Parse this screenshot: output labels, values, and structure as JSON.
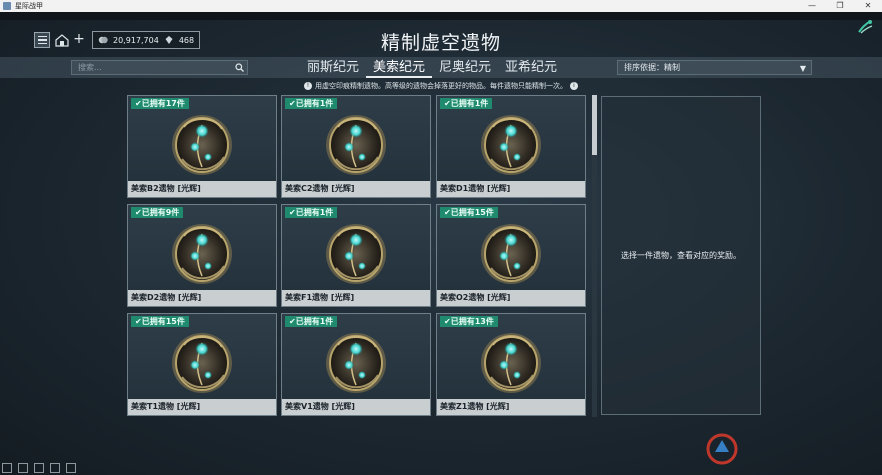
{
  "window": {
    "title": "星际战甲",
    "controls": [
      "—",
      "❐",
      "✕"
    ]
  },
  "toolbar": {
    "credits": "20,917,704",
    "platinum": "468"
  },
  "page": {
    "title": "精制虚空遗物",
    "info": "用虚空印痕精制遗物。高等级的遗物会掉落更好的物品。每件遗物只能精制一次。"
  },
  "search": {
    "placeholder": "搜索..."
  },
  "tabs": [
    {
      "label": "丽斯纪元",
      "active": false
    },
    {
      "label": "美索纪元",
      "active": true
    },
    {
      "label": "尼奥纪元",
      "active": false
    },
    {
      "label": "亚希纪元",
      "active": false
    }
  ],
  "sort": {
    "label": "排序依据：精制"
  },
  "relics": [
    {
      "owned": "已拥有17件",
      "name": "美索B2遗物 [光辉]"
    },
    {
      "owned": "已拥有1件",
      "name": "美索C2遗物 [光辉]"
    },
    {
      "owned": "已拥有1件",
      "name": "美索D1遗物 [光辉]"
    },
    {
      "owned": "已拥有9件",
      "name": "美索D2遗物 [光辉]"
    },
    {
      "owned": "已拥有1件",
      "name": "美索F1遗物 [光辉]"
    },
    {
      "owned": "已拥有15件",
      "name": "美索O2遗物 [光辉]"
    },
    {
      "owned": "已拥有15件",
      "name": "美索T1遗物 [光辉]"
    },
    {
      "owned": "已拥有1件",
      "name": "美索V1遗物 [光辉]"
    },
    {
      "owned": "已拥有13件",
      "name": "美索Z1遗物 [光辉]"
    }
  ],
  "reward_panel": {
    "message": "选择一件遗物，查看对应的奖励。"
  },
  "colors": {
    "owned_badge": "#1f8a6e",
    "name_bar": "#c9ced1"
  }
}
